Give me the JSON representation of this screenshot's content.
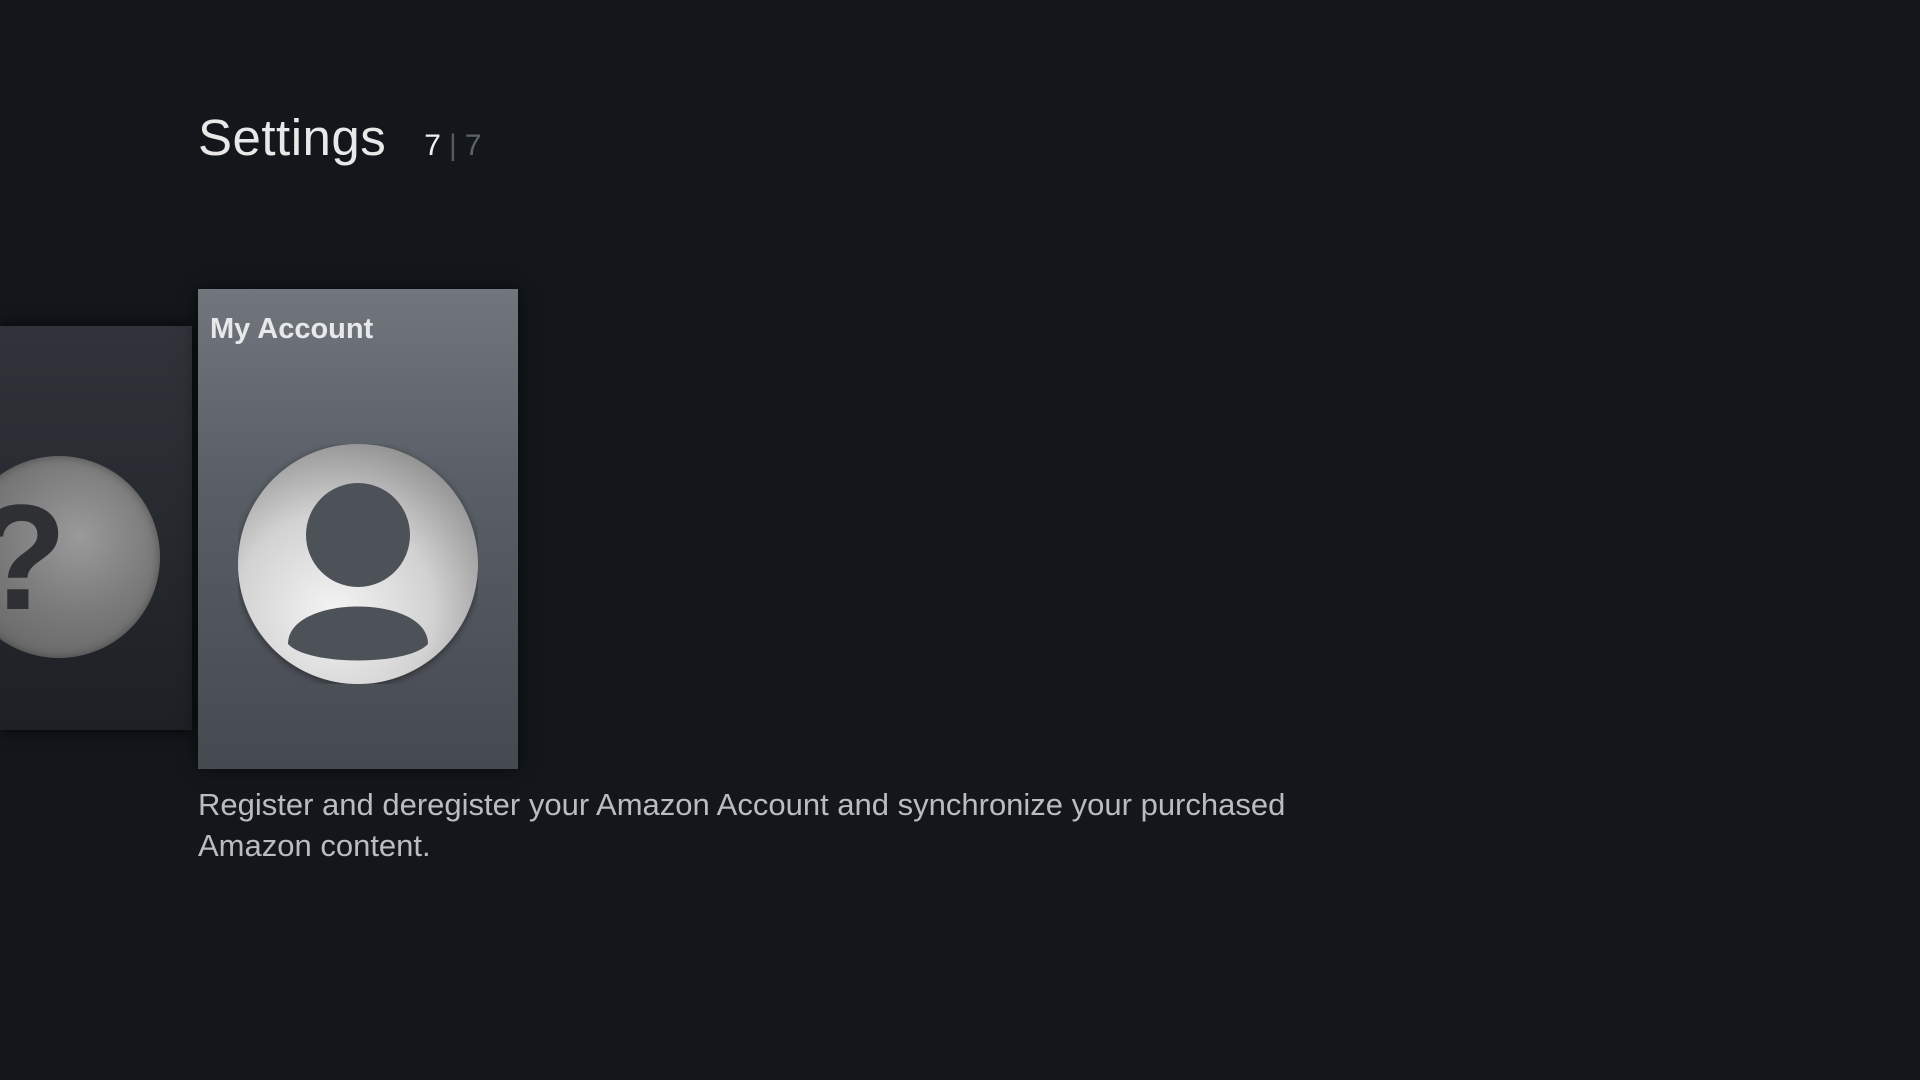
{
  "header": {
    "title": "Settings",
    "counter_current": "7",
    "counter_separator": "|",
    "counter_total": "7"
  },
  "cards": {
    "previous": {
      "icon": "help-question-icon",
      "glyph": "?"
    },
    "focused": {
      "title": "My Account",
      "icon": "user-account-icon"
    }
  },
  "description": "Register and deregister your Amazon Account and synchronize your purchased Amazon content.",
  "colors": {
    "background": "#13171b",
    "focused_card_top": "#71767d",
    "focused_card_bottom": "#454950",
    "text_primary": "#e8e8e8",
    "text_secondary": "#b9bcc0"
  }
}
